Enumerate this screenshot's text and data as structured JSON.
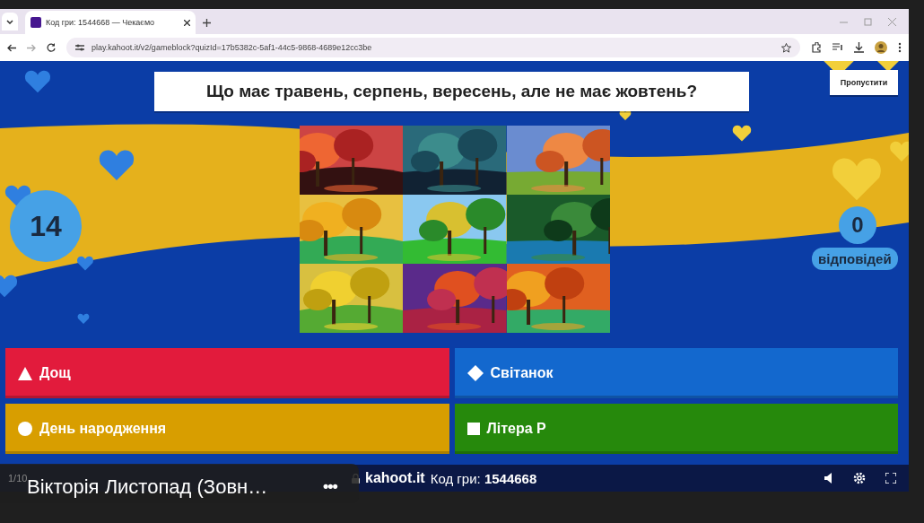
{
  "browser": {
    "tab_title": "Код гри: 1544668 — Чекаємо",
    "url": "play.kahoot.it/v2/gameblock?quizId=17b5382c-5af1-44c5-9868-4689e12cc3be"
  },
  "game": {
    "question": "Що має травень, серпень, вересень, але не має жовтень?",
    "skip_button": "Пропустити",
    "timer": "14",
    "answers_count": "0",
    "answers_label": "відповідей",
    "answers": [
      {
        "kind": "triangle",
        "label": "Дощ",
        "color": "#e21b3c"
      },
      {
        "kind": "diamond",
        "label": "Світанок",
        "color": "#1368ce"
      },
      {
        "kind": "circle",
        "label": "День народження",
        "color": "#d89e00"
      },
      {
        "kind": "square",
        "label": "Літера Р",
        "color": "#26890c"
      }
    ]
  },
  "footer": {
    "site": "kahoot.it",
    "game_code": "Код гри: **1544668**"
  },
  "call_overlay": {
    "counter": "1/10",
    "participant": "Вікторія Листопад (Зовн…",
    "more": "•••"
  }
}
